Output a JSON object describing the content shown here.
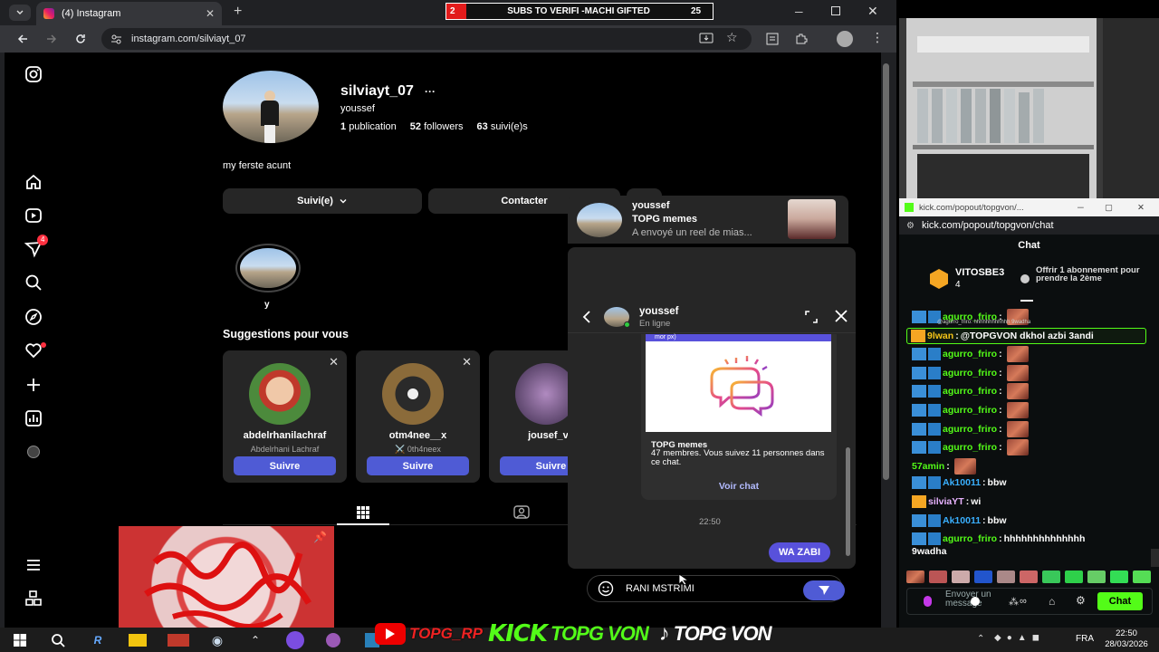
{
  "browser": {
    "tab_title": "(4) Instagram",
    "new_tab": "+",
    "url": "instagram.com/silviayt_07",
    "ticker": {
      "left": "2",
      "text": "SUBS TO VERIFI -MACHI GIFTED",
      "right": "25"
    }
  },
  "profile": {
    "username": "silviayt_07",
    "more": "···",
    "full_name": "youssef",
    "posts": "1",
    "posts_label": "publication",
    "followers": "52",
    "followers_label": "followers",
    "following": "63",
    "following_label": "suivi(e)s",
    "bio": "my ferste acunt",
    "follow_button": "Suivi(e)",
    "contact_button": "Contacter",
    "highlight_label": "y",
    "suggestions_title": "Suggestions pour vous",
    "suggestions": [
      {
        "name": "abdelrhanilachraf",
        "sub": "Abdelrhani Lachraf",
        "button": "Suivre"
      },
      {
        "name": "otm4nee__x",
        "sub": "⚔️ 0th4neex",
        "button": "Suivre"
      },
      {
        "name": "jousef_vv",
        "sub": "",
        "button": "Suivre"
      }
    ],
    "notif_badge": "4"
  },
  "dm_preview": {
    "name": "youssef",
    "group": "TOPG memes",
    "message": "A envoyé un reel de mias..."
  },
  "dm": {
    "name": "youssef",
    "status": "En ligne",
    "card_top": "mor px)",
    "card_title": "TOPG memes",
    "card_desc": "47 membres. Vous suivez 11 personnes dans ce chat.",
    "card_link": "Voir chat",
    "time": "22:50",
    "sent": "WA ZABI",
    "input_value": "RANI MSTRIMI"
  },
  "kick": {
    "window_title": "kick.com/popout/topgvon/...",
    "url": "kick.com/popout/topgvon/chat",
    "chat_title": "Chat",
    "top_gifter": "VITOSBE3",
    "top_count": "4",
    "gift_text": "Offrir 1 abonnement pour prendre la 2ème",
    "tiny_text": "@agurro_friro: hhhhhhhhhhhh 9wadha",
    "messages": [
      {
        "user": "agurro_friro",
        "text": "",
        "color": "#53fc18",
        "emote": true,
        "badge": "blue"
      },
      {
        "user": "9lwan",
        "text": " @TOPGVON dkhol azbi 3andi",
        "color": "#f5c518",
        "emote": false,
        "badge": "gold",
        "highlight": true
      },
      {
        "user": "agurro_friro",
        "text": "",
        "color": "#53fc18",
        "emote": true,
        "badge": "blue"
      },
      {
        "user": "agurro_friro",
        "text": "",
        "color": "#53fc18",
        "emote": true,
        "badge": "blue"
      },
      {
        "user": "agurro_friro",
        "text": "",
        "color": "#53fc18",
        "emote": true,
        "badge": "blue"
      },
      {
        "user": "agurro_friro",
        "text": "",
        "color": "#53fc18",
        "emote": true,
        "badge": "blue"
      },
      {
        "user": "agurro_friro",
        "text": "",
        "color": "#53fc18",
        "emote": true,
        "badge": "blue"
      },
      {
        "user": "agurro_friro",
        "text": "",
        "color": "#53fc18",
        "emote": true,
        "badge": "blue"
      },
      {
        "user": "57amin",
        "text": "",
        "color": "#53fc18",
        "emote": true,
        "badge": "none"
      },
      {
        "user": "Ak10011",
        "text": " bbw",
        "color": "#3ab0ff",
        "emote": false,
        "badge": "blue"
      },
      {
        "user": "silviaYT",
        "text": " wi",
        "color": "#e8b3ff",
        "emote": false,
        "badge": "gold"
      },
      {
        "user": "Ak10011",
        "text": " bbw",
        "color": "#3ab0ff",
        "emote": false,
        "badge": "blue"
      },
      {
        "user": "agurro_friro",
        "text": " hhhhhhhhhhhhhh",
        "color": "#53fc18",
        "emote": false,
        "badge": "blue"
      }
    ],
    "wrap_text": "9wadha",
    "input_placeholder": "Envoyer un message",
    "chat_button": "Chat"
  },
  "overlay": {
    "t1": "TOPG_RP",
    "t2": "KICK",
    "t3": "TOPG VON",
    "t4": "TOPG VON"
  },
  "taskbar": {
    "lang": "FRA",
    "time": "22:50",
    "date": "28/03/2026"
  },
  "colors": {
    "ig_blue": "#4f5bd5",
    "kick_green": "#53fc18",
    "dm_bubble": "#5851db"
  }
}
